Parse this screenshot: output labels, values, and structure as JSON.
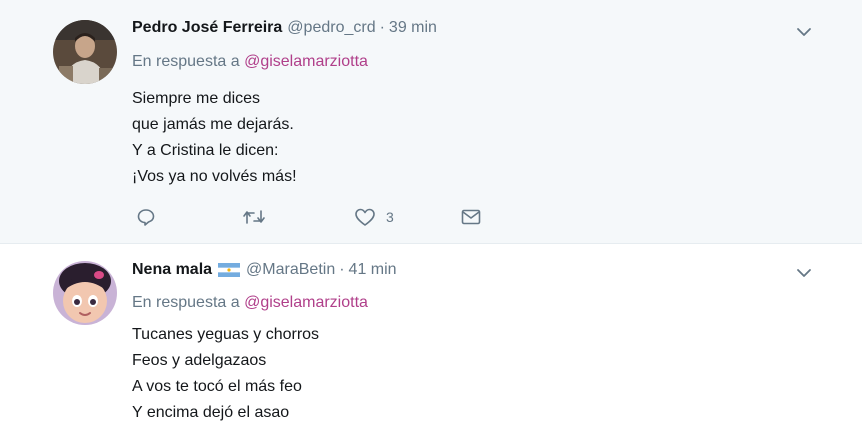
{
  "tweets": [
    {
      "author_name": "Pedro José Ferreira",
      "handle": "@pedro_crd",
      "separator": "·",
      "time": "39 min",
      "reply_prefix": "En respuesta a",
      "reply_to": "@giselamarziotta",
      "lines": [
        "Siempre me dices",
        "que jamás me dejarás.",
        "Y a Cristina le dicen:",
        "¡Vos ya no volvés más!"
      ],
      "actions": {
        "reply_count": "",
        "retweet_count": "",
        "like_count": "3"
      }
    },
    {
      "author_name": "Nena mala",
      "flag_icon": "argentina-flag-icon",
      "handle": "@MaraBetin",
      "separator": "·",
      "time": "41 min",
      "reply_prefix": "En respuesta a",
      "reply_to": "@giselamarziotta",
      "lines": [
        "Tucanes yeguas y chorros",
        "Feos y adelgazaos",
        "A vos te tocó el más feo",
        "Y encima dejó el asao"
      ]
    }
  ],
  "icons": {
    "more": "chevron-down-icon",
    "reply": "reply-bubble-icon",
    "retweet": "retweet-icon",
    "like": "heart-icon",
    "message": "envelope-icon"
  },
  "colors": {
    "mention": "#b03f8a",
    "secondary_text": "#657786",
    "primary_text": "#14171a",
    "tweet_1_bg": "#f5f8fa"
  }
}
